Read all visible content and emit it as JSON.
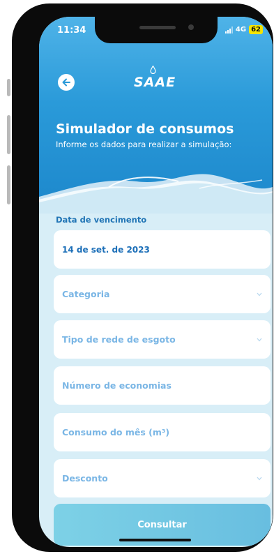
{
  "status_bar": {
    "time": "11:34",
    "network": "4G",
    "battery": "62"
  },
  "header": {
    "logo_text": "SAAE",
    "title": "Simulador de consumos",
    "subtitle": "Informe os dados para realizar a simulação:"
  },
  "form": {
    "due_date_label": "Data de vencimento",
    "due_date_value": "14 de set. de 2023",
    "category_placeholder": "Categoria",
    "sewer_type_placeholder": "Tipo de rede de esgoto",
    "economies_placeholder": "Número de economias",
    "consumption_placeholder": "Consumo do mês (m³)",
    "discount_placeholder": "Desconto",
    "submit_label": "Consultar"
  },
  "colors": {
    "header_blue": "#2a9ad9",
    "background": "#d8eef7",
    "label_blue": "#2074b5",
    "placeholder_blue": "#7ab6e5",
    "button": "#7dd1e6",
    "battery": "#f4e400"
  }
}
